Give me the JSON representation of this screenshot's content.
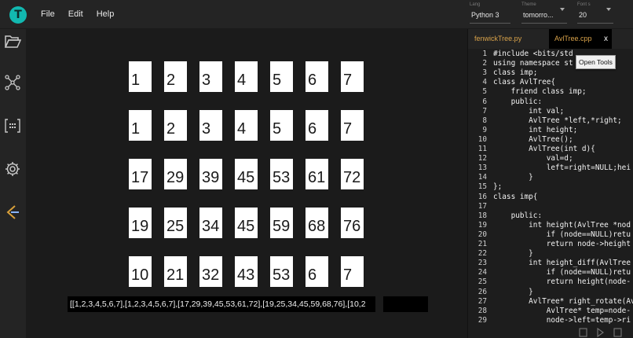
{
  "menu": {
    "file": "File",
    "edit": "Edit",
    "help": "Help"
  },
  "selectors": {
    "language": {
      "label": "Lang",
      "value": "Python 3"
    },
    "theme": {
      "label": "Theme",
      "value": "tomorro..."
    },
    "font_size": {
      "label": "Font s",
      "value": "20"
    }
  },
  "sidebar": {
    "icons": [
      "folder-open-icon",
      "graph-nodes-icon",
      "array-brackets-icon",
      "gear-icon",
      "leetcode-icon"
    ]
  },
  "grid": {
    "rows": [
      [
        "1",
        "2",
        "3",
        "4",
        "5",
        "6",
        "7"
      ],
      [
        "1",
        "2",
        "3",
        "4",
        "5",
        "6",
        "7"
      ],
      [
        "17",
        "29",
        "39",
        "45",
        "53",
        "61",
        "72"
      ],
      [
        "19",
        "25",
        "34",
        "45",
        "59",
        "68",
        "76"
      ],
      [
        "10",
        "21",
        "32",
        "43",
        "53",
        "6",
        "7"
      ]
    ]
  },
  "output_text": "[[1,2,3,4,5,6,7],[1,2,3,4,5,6,7],[17,29,39,45,53,61,72],[19,25,34,45,59,68,76],[10,2",
  "editor": {
    "tabs": [
      {
        "label": "fenwickTree.py",
        "active": false
      },
      {
        "label": "AvlTree.cpp",
        "active": true
      }
    ],
    "close_label": "x",
    "tooltip": "Open Tools",
    "lines": [
      {
        "n": "1",
        "t": "#include <bits/std"
      },
      {
        "n": "2",
        "t": "using namespace st"
      },
      {
        "n": "3",
        "t": "class imp;"
      },
      {
        "n": "4",
        "t": "class AvlTree{"
      },
      {
        "n": "5",
        "t": "    friend class imp;"
      },
      {
        "n": "6",
        "t": "    public:"
      },
      {
        "n": "7",
        "t": "        int val;"
      },
      {
        "n": "8",
        "t": "        AvlTree *left,*right;"
      },
      {
        "n": "9",
        "t": "        int height;"
      },
      {
        "n": "10",
        "t": "        AvlTree();"
      },
      {
        "n": "11",
        "t": "        AvlTree(int d){"
      },
      {
        "n": "12",
        "t": "            val=d;"
      },
      {
        "n": "13",
        "t": "            left=right=NULL;hei"
      },
      {
        "n": "14",
        "t": "        }"
      },
      {
        "n": "15",
        "t": "};"
      },
      {
        "n": "16",
        "t": "class imp{"
      },
      {
        "n": "17",
        "t": ""
      },
      {
        "n": "18",
        "t": "    public:"
      },
      {
        "n": "19",
        "t": "        int height(AvlTree *nod"
      },
      {
        "n": "20",
        "t": "            if (node==NULL)retu"
      },
      {
        "n": "21",
        "t": "            return node->height"
      },
      {
        "n": "22",
        "t": "        }"
      },
      {
        "n": "23",
        "t": "        int height_diff(AvlTree"
      },
      {
        "n": "24",
        "t": "            if (node==NULL)retu"
      },
      {
        "n": "25",
        "t": "            return height(node-"
      },
      {
        "n": "26",
        "t": "        }"
      },
      {
        "n": "27",
        "t": "        AvlTree* right_rotate(Av"
      },
      {
        "n": "28",
        "t": "            AvlTree* temp=node-"
      },
      {
        "n": "29",
        "t": "            node->left=temp->ri"
      }
    ]
  }
}
